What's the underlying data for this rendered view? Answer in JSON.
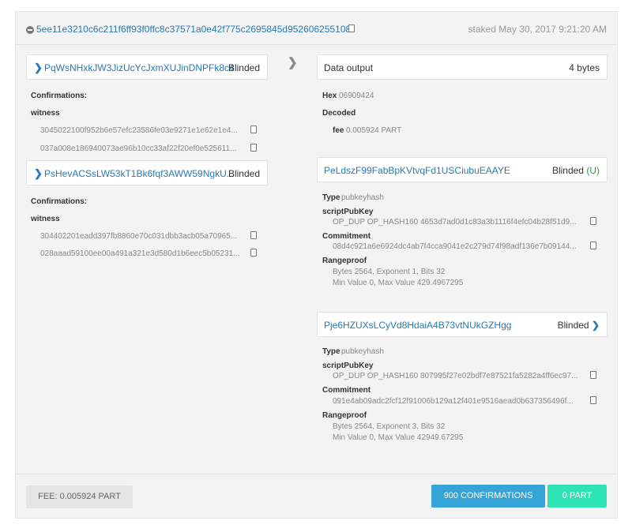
{
  "tx": {
    "id": "5ee11e3210c6c211f6ff93f0ffc8c37571a0e42f775c2695845d952606255108",
    "staked": "staked May 30, 2017 9:21:20 AM"
  },
  "inputs": [
    {
      "address": "PqWsNHxkJW3JizUcYcJxmXUJinDNPFk8c4",
      "tag": "Blinded",
      "confirmations_label": "Confirmations:",
      "witness_label": "witness",
      "witness": [
        "3045022100f952b6e57efc23586fe03e9271e1e62e1e4...",
        "037a008e186940073ae96b10cc33af22f20ef0e525611..."
      ]
    },
    {
      "address": "PsHevACSsLW53kT1Bk6fqf3AWW59NgkU...",
      "tag": "Blinded",
      "confirmations_label": "Confirmations:",
      "witness_label": "witness",
      "witness": [
        "304402201eadd397fb8860e70c031dbb3acb05a70965...",
        "028aaad59100ee00a491a321e3d580d1b6eec5b05231..."
      ]
    }
  ],
  "data_output": {
    "title": "Data output",
    "size": "4 bytes",
    "hex_label": "Hex",
    "hex": "06909424",
    "decoded_label": "Decoded",
    "fee_label": "fee",
    "fee": "0.005924 PART"
  },
  "outputs": [
    {
      "address": "PeLdszF99FabBpKVtvqFd1USCiubuEAAYE",
      "tag": "Blinded",
      "tag_suffix": "(U)",
      "type_label": "Type",
      "type": "pubkeyhash",
      "script_label": "scriptPubKey",
      "script": "OP_DUP OP_HASH160 4653d7ad0d1c83a3b1116f4efc04b28f51d9...",
      "commitment_label": "Commitment",
      "commitment": "08d4c921a6e6924dc4ab7f4cca9041e2c279d74f98adf136e7b09144...",
      "rangeproof_label": "Rangeproof",
      "rangeproof_1": "Bytes 2564, Exponent 1, Bits 32",
      "rangeproof_2": "Min Value 0, Max Value 429.4967295"
    },
    {
      "address": "Pje6HZUXsLCyVd8HdaiA4B73vtNUkGZHgg",
      "tag": "Blinded",
      "type_label": "Type",
      "type": "pubkeyhash",
      "script_label": "scriptPubKey",
      "script": "OP_DUP OP_HASH160 807995f27e02bdf7e87521fa5282a4ff6ec97...",
      "commitment_label": "Commitment",
      "commitment": "091e4ab09adc2fcf12f91006b129a12f401e9516aead0b637356496f...",
      "rangeproof_label": "Rangeproof",
      "rangeproof_1": "Bytes 2564, Exponent 3, Bits 32",
      "rangeproof_2": "Min Value 0, Max Value 42949.67295"
    }
  ],
  "footer": {
    "fee": "FEE: 0.005924 PART",
    "confirmations": "900 CONFIRMATIONS",
    "amount": "0 PART"
  }
}
